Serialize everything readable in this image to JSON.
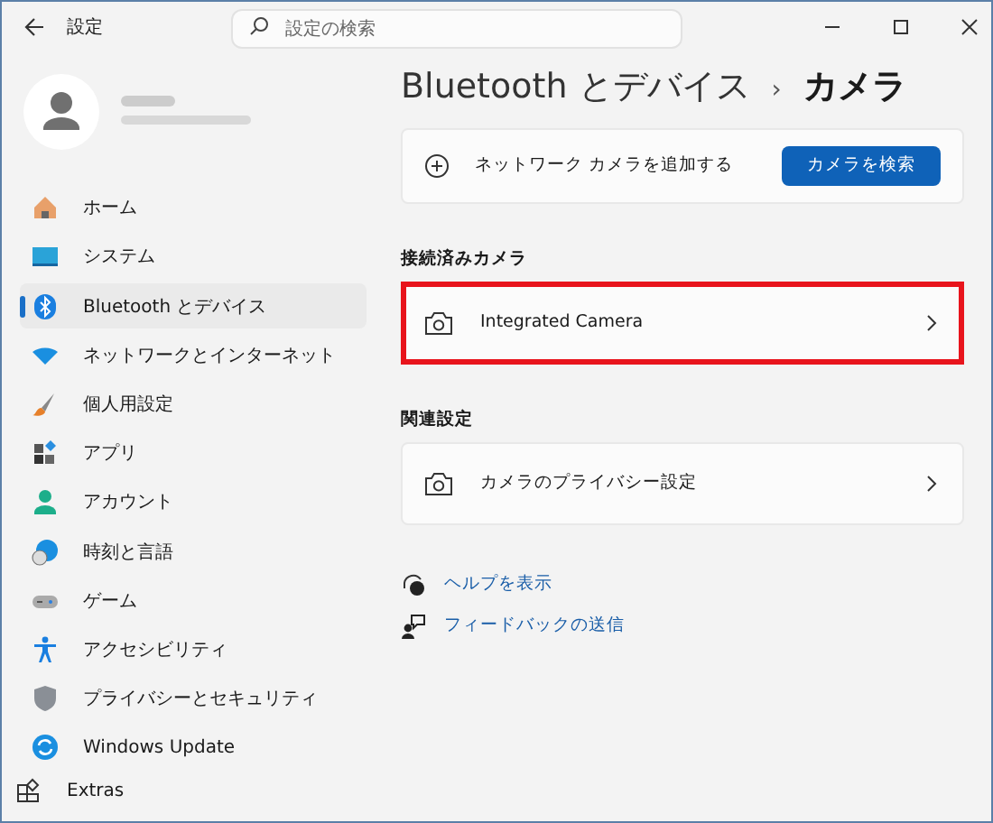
{
  "window": {
    "title": "設定"
  },
  "search": {
    "placeholder": "設定の検索"
  },
  "sidebar": {
    "items": [
      {
        "label": "ホーム",
        "selected": false
      },
      {
        "label": "システム",
        "selected": false
      },
      {
        "label": "Bluetooth とデバイス",
        "selected": true
      },
      {
        "label": "ネットワークとインターネット",
        "selected": false
      },
      {
        "label": "個人用設定",
        "selected": false
      },
      {
        "label": "アプリ",
        "selected": false
      },
      {
        "label": "アカウント",
        "selected": false
      },
      {
        "label": "時刻と言語",
        "selected": false
      },
      {
        "label": "ゲーム",
        "selected": false
      },
      {
        "label": "アクセシビリティ",
        "selected": false
      },
      {
        "label": "プライバシーとセキュリティ",
        "selected": false
      },
      {
        "label": "Windows Update",
        "selected": false
      }
    ],
    "extras": "Extras"
  },
  "breadcrumb": {
    "parent": "Bluetooth とデバイス",
    "separator": "›",
    "current": "カメラ"
  },
  "add_camera": {
    "label": "ネットワーク カメラを追加する",
    "button": "カメラを検索"
  },
  "sections": [
    {
      "heading": "接続済みカメラ",
      "rows": [
        {
          "label": "Integrated Camera",
          "highlighted": true
        }
      ]
    },
    {
      "heading": "関連設定",
      "rows": [
        {
          "label": "カメラのプライバシー設定",
          "highlighted": false
        }
      ]
    }
  ],
  "links": [
    {
      "label": "ヘルプを表示"
    },
    {
      "label": "フィードバックの送信"
    }
  ]
}
